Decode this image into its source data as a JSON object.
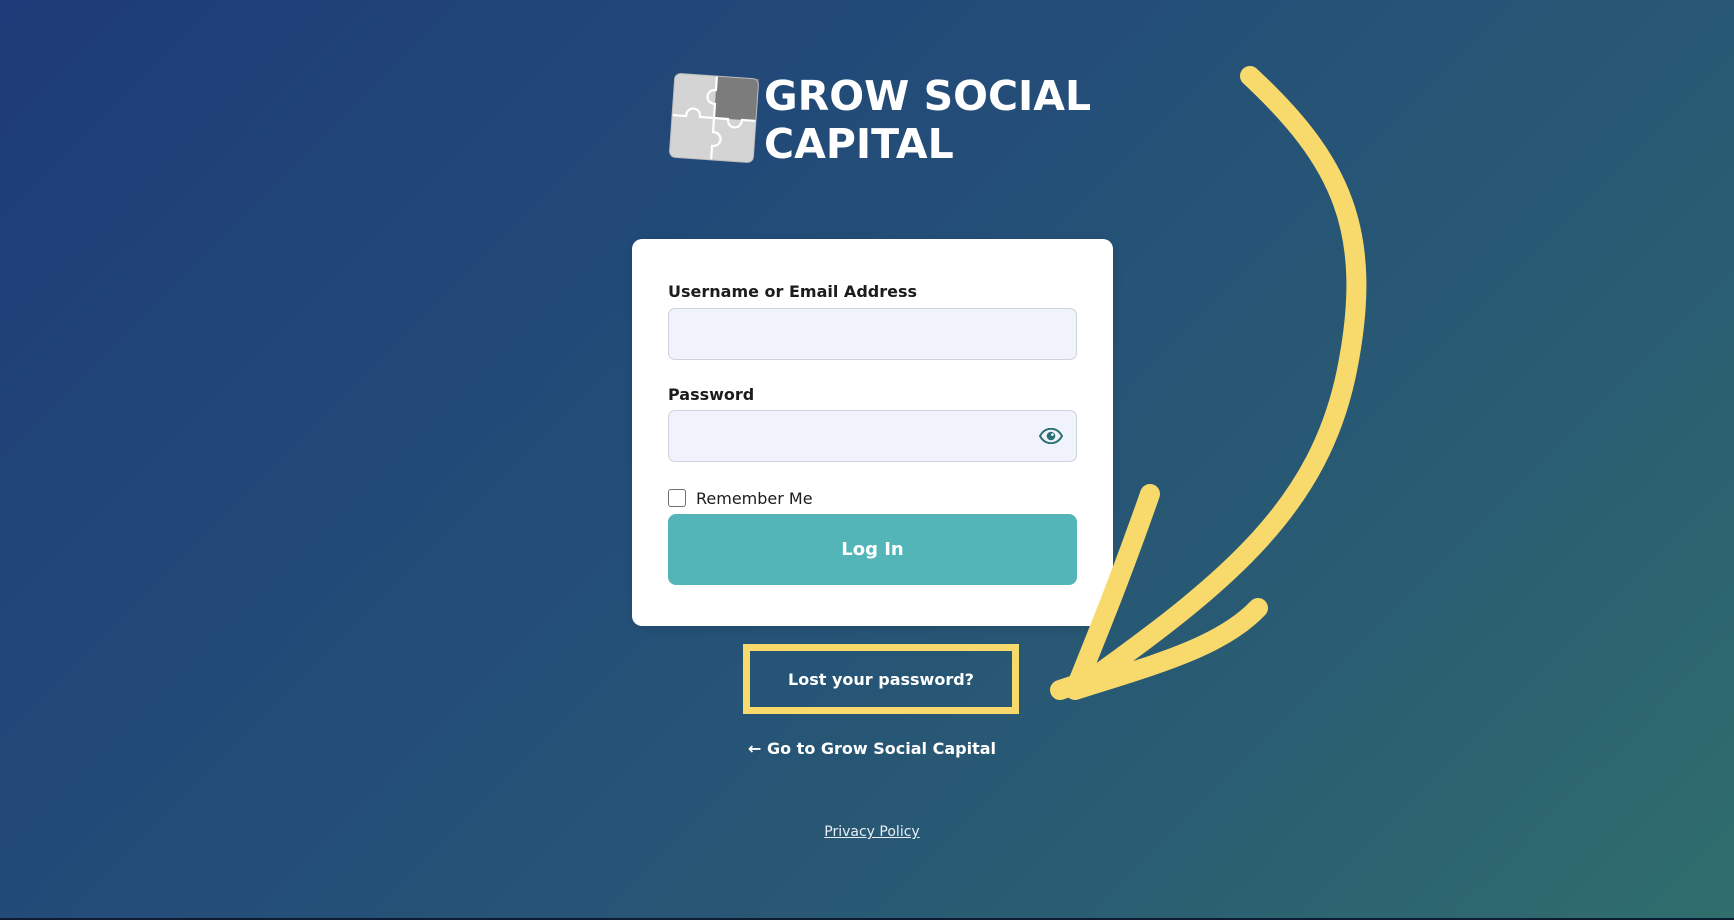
{
  "brand": {
    "logo_line1": "GROW SOCIAL",
    "logo_line2": "CAPITAL"
  },
  "login_form": {
    "username_label": "Username or Email Address",
    "username_value": "",
    "password_label": "Password",
    "password_value": "",
    "show_password_icon": "eye-icon",
    "remember_label": "Remember Me",
    "remember_checked": false,
    "submit_label": "Log In"
  },
  "links": {
    "lost_password": "Lost your password?",
    "back_to_site": "← Go to Grow Social Capital",
    "privacy_policy": "Privacy Policy"
  },
  "annotation": {
    "highlight_color": "#f8d96b",
    "arrow_icon": "curved-arrow-icon"
  },
  "colors": {
    "accent": "#53b5b7",
    "background_start": "#1d3b78",
    "background_end": "#2f6e6d",
    "eye_icon": "#2a6f73"
  }
}
